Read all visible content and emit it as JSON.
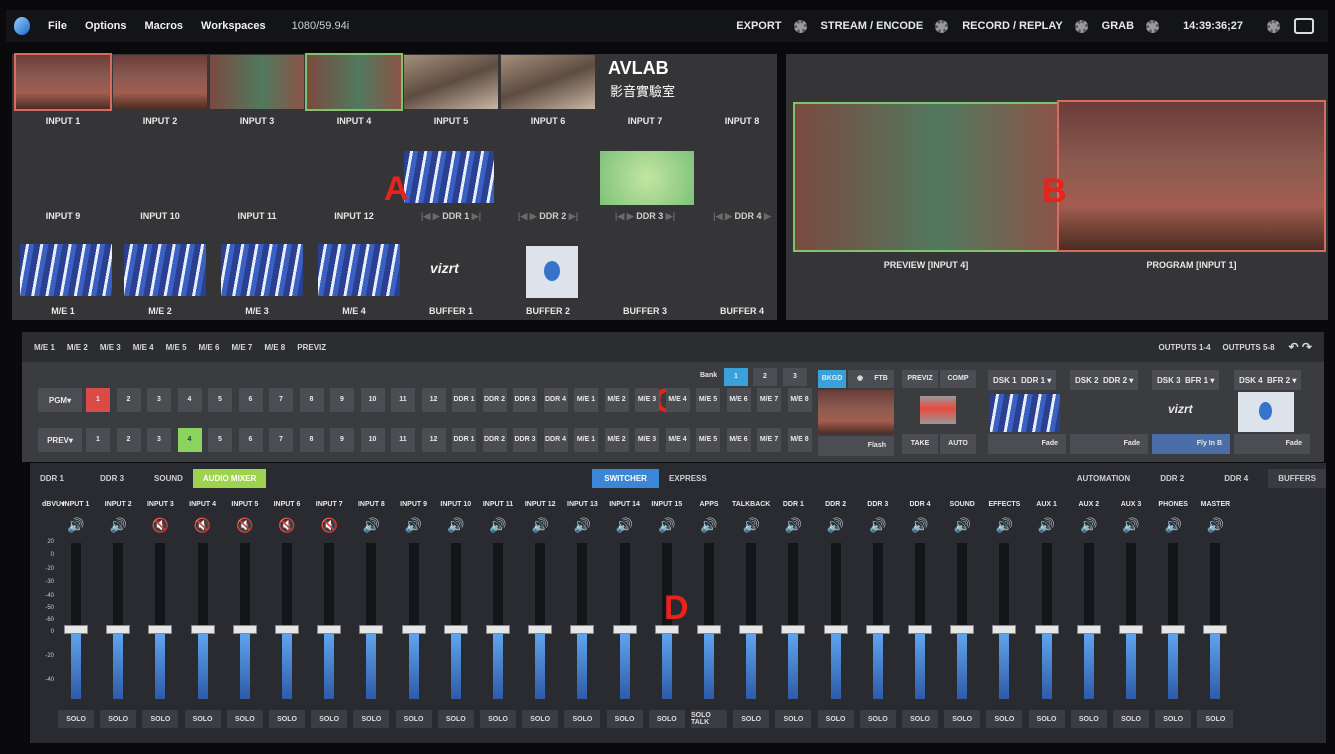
{
  "menubar": {
    "items": [
      "File",
      "Options",
      "Macros",
      "Workspaces"
    ],
    "format": "1080/59.94i",
    "right": [
      "EXPORT",
      "STREAM / ENCODE",
      "RECORD / REPLAY",
      "GRAB"
    ],
    "time": "14:39:36;27"
  },
  "monitorA": {
    "inputs_row1": [
      "INPUT 1",
      "INPUT 2",
      "INPUT 3",
      "INPUT 4",
      "INPUT 5",
      "INPUT 6",
      "INPUT 7",
      "INPUT 8"
    ],
    "inputs_row2": [
      "INPUT 9",
      "INPUT 10",
      "INPUT 11",
      "INPUT 12"
    ],
    "ddr": [
      "DDR 1",
      "DDR 2",
      "DDR 3",
      "DDR 4"
    ],
    "row3": [
      "M/E 1",
      "M/E 2",
      "M/E 3",
      "M/E 4",
      "BUFFER 1",
      "BUFFER 2",
      "BUFFER 3",
      "BUFFER 4"
    ],
    "avlab": "AVLAB",
    "avlab_cn": "影音實驗室",
    "vizrt": "vizrt"
  },
  "monitorB": {
    "preview_label": "PREVIEW [INPUT 4]",
    "program_label": "PROGRAM [INPUT 1]"
  },
  "markers": {
    "a": "A",
    "b": "B",
    "c": "C",
    "d": "D"
  },
  "switcher": {
    "tabs": [
      "M/E 1",
      "M/E 2",
      "M/E 3",
      "M/E 4",
      "M/E 5",
      "M/E 6",
      "M/E 7",
      "M/E 8",
      "PREVIZ"
    ],
    "outputs": [
      "OUTPUTS 1-4",
      "OUTPUTS 5-8"
    ],
    "pgm_label": "PGM",
    "prev_label": "PREV",
    "bank_label": "Bank",
    "banks": [
      "1",
      "2",
      "3"
    ],
    "buttons": [
      "1",
      "2",
      "3",
      "4",
      "5",
      "6",
      "7",
      "8",
      "9",
      "10",
      "11",
      "12",
      "DDR 1",
      "DDR 2",
      "DDR 3",
      "DDR 4",
      "M/E 1",
      "M/E 2",
      "M/E 3",
      "M/E 4",
      "M/E 5",
      "M/E 6",
      "M/E 7",
      "M/E 8"
    ],
    "bkgd": "BKGD",
    "ftb": "FTB",
    "flash": "Flash",
    "previz": "PREVIZ",
    "comp": "COMP",
    "take": "TAKE",
    "auto": "AUTO",
    "dsk": [
      {
        "name": "DSK 1",
        "src": "DDR 1",
        "action": "Fade"
      },
      {
        "name": "DSK 2",
        "src": "DDR 2",
        "action": "Fade"
      },
      {
        "name": "DSK 3",
        "src": "BFR 1",
        "action": "Fly In B"
      },
      {
        "name": "DSK 4",
        "src": "BFR 2",
        "action": "Fade"
      }
    ]
  },
  "mixer": {
    "tabs_left": [
      "DDR 1",
      "DDR 3",
      "SOUND",
      "AUDIO MIXER"
    ],
    "tabs_mid": [
      "SWITCHER",
      "EXPRESS"
    ],
    "tabs_right": [
      "AUTOMATION",
      "DDR 2",
      "DDR 4",
      "BUFFERS"
    ],
    "unit": "dBVU",
    "scale": [
      "20",
      "0",
      "-20",
      "-30",
      "-40",
      "-50",
      "-60",
      "0",
      "-20",
      "-40"
    ],
    "channels": [
      {
        "name": "INPUT 1",
        "muted": false,
        "solo": "SOLO"
      },
      {
        "name": "INPUT 2",
        "muted": false,
        "solo": "SOLO"
      },
      {
        "name": "INPUT 3",
        "muted": true,
        "solo": "SOLO"
      },
      {
        "name": "INPUT 4",
        "muted": true,
        "solo": "SOLO"
      },
      {
        "name": "INPUT 5",
        "muted": true,
        "solo": "SOLO"
      },
      {
        "name": "INPUT 6",
        "muted": true,
        "solo": "SOLO"
      },
      {
        "name": "INPUT 7",
        "muted": true,
        "solo": "SOLO"
      },
      {
        "name": "INPUT 8",
        "muted": false,
        "solo": "SOLO"
      },
      {
        "name": "INPUT 9",
        "muted": false,
        "solo": "SOLO"
      },
      {
        "name": "INPUT 10",
        "muted": false,
        "solo": "SOLO"
      },
      {
        "name": "INPUT 11",
        "muted": false,
        "solo": "SOLO"
      },
      {
        "name": "INPUT 12",
        "muted": false,
        "solo": "SOLO"
      },
      {
        "name": "INPUT 13",
        "muted": false,
        "solo": "SOLO"
      },
      {
        "name": "INPUT 14",
        "muted": false,
        "solo": "SOLO"
      },
      {
        "name": "INPUT 15",
        "muted": false,
        "solo": "SOLO"
      },
      {
        "name": "APPS",
        "muted": false,
        "solo": "SOLO TALK"
      },
      {
        "name": "TALKBACK",
        "muted": false,
        "solo": "SOLO"
      },
      {
        "name": "DDR 1",
        "muted": false,
        "solo": "SOLO"
      },
      {
        "name": "DDR 2",
        "muted": false,
        "solo": "SOLO"
      },
      {
        "name": "DDR 3",
        "muted": false,
        "solo": "SOLO"
      },
      {
        "name": "DDR 4",
        "muted": false,
        "solo": "SOLO"
      },
      {
        "name": "SOUND",
        "muted": false,
        "solo": "SOLO"
      },
      {
        "name": "EFFECTS",
        "muted": false,
        "solo": "SOLO"
      },
      {
        "name": "AUX 1",
        "muted": false,
        "solo": "SOLO"
      },
      {
        "name": "AUX 2",
        "muted": false,
        "solo": "SOLO"
      },
      {
        "name": "AUX 3",
        "muted": false,
        "solo": "SOLO"
      },
      {
        "name": "PHONES",
        "muted": false,
        "solo": "SOLO"
      },
      {
        "name": "MASTER",
        "muted": false,
        "solo": "SOLO"
      }
    ]
  }
}
